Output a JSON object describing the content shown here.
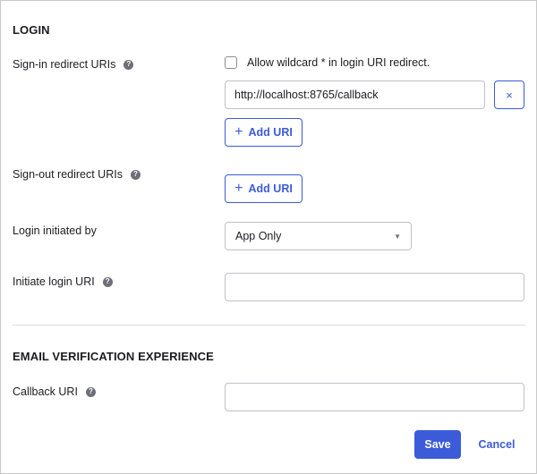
{
  "login": {
    "title": "LOGIN",
    "signin": {
      "label": "Sign-in redirect URIs",
      "wildcard_label": "Allow wildcard * in login URI redirect.",
      "uri_value": "http://localhost:8765/callback",
      "remove_icon": "×",
      "add_label": "Add URI"
    },
    "signout": {
      "label": "Sign-out redirect URIs",
      "add_label": "Add URI"
    },
    "initiated_by": {
      "label": "Login initiated by",
      "value": "App Only"
    },
    "initiate_uri": {
      "label": "Initiate login URI",
      "value": ""
    }
  },
  "email_verification": {
    "title": "EMAIL VERIFICATION EXPERIENCE",
    "callback": {
      "label": "Callback URI",
      "value": ""
    }
  },
  "actions": {
    "save_label": "Save",
    "cancel_label": "Cancel"
  },
  "icons": {
    "help": "?",
    "plus": "+",
    "caret": "▼"
  },
  "colors": {
    "accent": "#3b5bd9",
    "help_icon": "#6e6e78",
    "border": "#c1c1c8"
  }
}
